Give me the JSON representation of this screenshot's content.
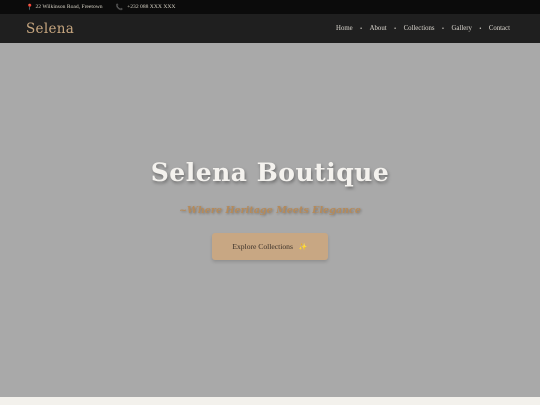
{
  "topbar": {
    "address": "22 Wilkinson Road, Freetown",
    "phone": "+232 088 XXX XXX",
    "icons": [
      "pin-icon",
      "phone-icon"
    ]
  },
  "navbar": {
    "brand": "Selena",
    "links": [
      "Home",
      "About",
      "Collections",
      "Gallery",
      "Contact"
    ]
  },
  "hero": {
    "title": "Selena Boutique",
    "tagline": "~Where Heritage Meets Elegance",
    "cta_label": "Explore Collections",
    "cta_icon": "sparkle-icon"
  },
  "colors": {
    "topbar_bg": "#0b0b0b",
    "navbar_bg": "#1f1f1f",
    "brand": "#c8a780",
    "hero_bg": "#a9a9a9",
    "accent": "#c8a783"
  }
}
